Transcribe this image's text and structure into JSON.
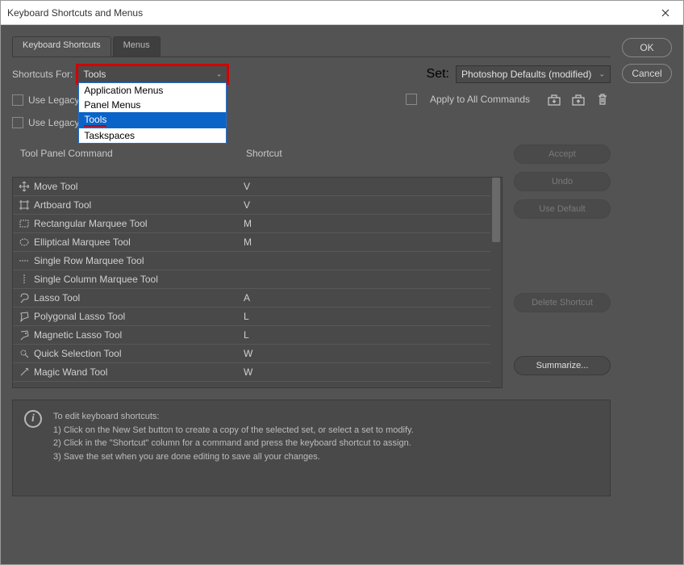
{
  "window": {
    "title": "Keyboard Shortcuts and Menus"
  },
  "side": {
    "ok": "OK",
    "cancel": "Cancel"
  },
  "tabs": {
    "t1": "Keyboard Shortcuts",
    "t2": "Menus"
  },
  "shortcutsFor": {
    "label": "Shortcuts For:",
    "value": "Tools",
    "options": {
      "o1": "Application Menus",
      "o2": "Panel Menus",
      "o3": "Tools",
      "o4": "Taskspaces"
    }
  },
  "legacyUndo": "Use Legacy Undo Shortcuts",
  "legacyChannel": "Use Legacy Channel Shortcuts",
  "set": {
    "label": "Set:",
    "value": "Photoshop Defaults (modified)"
  },
  "applyAll": "Apply to All Commands",
  "buttons": {
    "accept": "Accept",
    "undo": "Undo",
    "useDefault": "Use Default",
    "deleteShortcut": "Delete Shortcut",
    "summarize": "Summarize..."
  },
  "columns": {
    "c1": "Tool Panel Command",
    "c2": "Shortcut"
  },
  "rows": [
    {
      "name": "Move Tool",
      "key": "V"
    },
    {
      "name": "Artboard Tool",
      "key": "V"
    },
    {
      "name": "Rectangular Marquee Tool",
      "key": "M"
    },
    {
      "name": "Elliptical Marquee Tool",
      "key": "M"
    },
    {
      "name": "Single Row Marquee Tool",
      "key": ""
    },
    {
      "name": "Single Column Marquee Tool",
      "key": ""
    },
    {
      "name": "Lasso Tool",
      "key": "A"
    },
    {
      "name": "Polygonal Lasso Tool",
      "key": "L"
    },
    {
      "name": "Magnetic Lasso Tool",
      "key": "L"
    },
    {
      "name": "Quick Selection Tool",
      "key": "W"
    },
    {
      "name": "Magic Wand Tool",
      "key": "W"
    }
  ],
  "info": {
    "l0": "To edit keyboard shortcuts:",
    "l1": "1) Click on the New Set button to create a copy of the selected set, or select a set to modify.",
    "l2": "2) Click in the \"Shortcut\" column for a command and press the keyboard shortcut to assign.",
    "l3": "3) Save the set when you are done editing to save all your changes."
  }
}
